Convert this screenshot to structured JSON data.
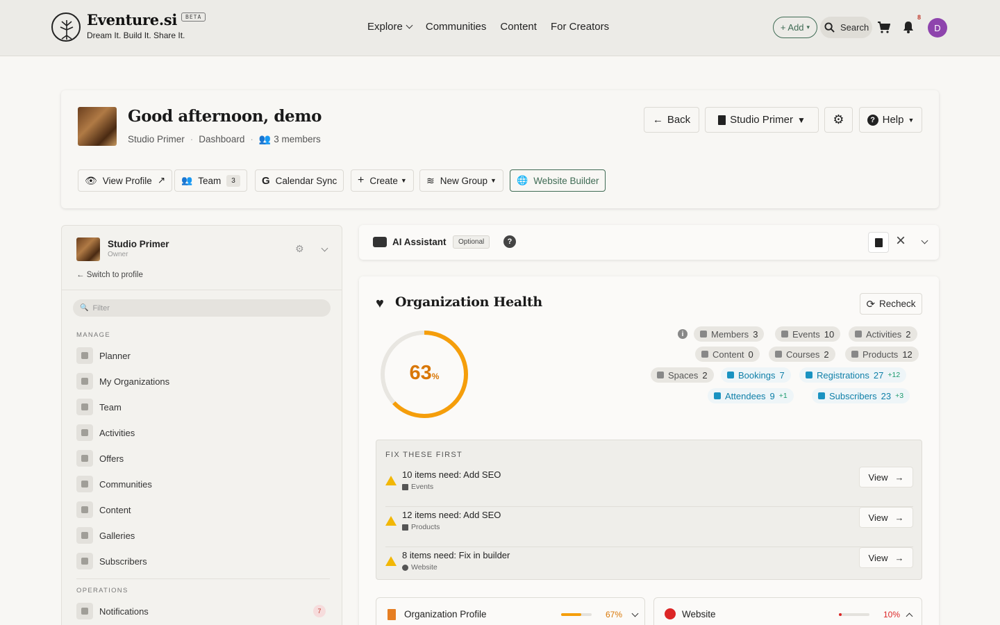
{
  "brand": {
    "name": "Eventure.si",
    "beta": "BETA",
    "tagline": "Dream It. Build It. Share It."
  },
  "nav": {
    "explore": "Explore",
    "communities": "Communities",
    "content": "Content",
    "creators": "For Creators"
  },
  "topbar": {
    "add": "+ Add",
    "search": "Search",
    "notif_count": "8",
    "avatar_initial": "D"
  },
  "header": {
    "greeting": "Good afternoon, demo",
    "org": "Studio Primer",
    "page": "Dashboard",
    "members": "3 members",
    "back": "Back",
    "org_switch": "Studio Primer",
    "help": "Help",
    "actions": {
      "view_profile": "View Profile",
      "team": "Team",
      "team_count": "3",
      "calendar": "Calendar Sync",
      "create": "Create",
      "new_group": "New Group",
      "website": "Website Builder"
    }
  },
  "sidebar": {
    "org_name": "Studio Primer",
    "role": "Owner",
    "switch": "Switch to profile",
    "filter_placeholder": "Filter",
    "manage_label": "MANAGE",
    "items": [
      "Planner",
      "My Organizations",
      "Team",
      "Activities",
      "Offers",
      "Communities",
      "Content",
      "Galleries",
      "Subscribers"
    ],
    "operations_label": "OPERATIONS",
    "notifications": "Notifications",
    "notifications_count": "7"
  },
  "ai": {
    "title": "AI Assistant",
    "optional": "Optional",
    "help": "?"
  },
  "health": {
    "title": "Organization Health",
    "recheck": "Recheck",
    "score": "63",
    "score_unit": "%",
    "score_fraction": 0.63,
    "accent": "#f59e0b",
    "stats": {
      "members_l": "Members",
      "members_v": "3",
      "events_l": "Events",
      "events_v": "10",
      "activities_l": "Activities",
      "activities_v": "2",
      "content_l": "Content",
      "content_v": "0",
      "courses_l": "Courses",
      "courses_v": "2",
      "products_l": "Products",
      "products_v": "12",
      "spaces_l": "Spaces",
      "spaces_v": "2",
      "bookings_l": "Bookings",
      "bookings_v": "7",
      "registrations_l": "Registrations",
      "registrations_v": "27",
      "registrations_d": "+12",
      "attendees_l": "Attendees",
      "attendees_v": "9",
      "attendees_d": "+1",
      "subscribers_l": "Subscribers",
      "subscribers_v": "23",
      "subscribers_d": "+3"
    },
    "fix_header": "FIX THESE FIRST",
    "fixes": [
      {
        "title": "10 items need: Add SEO",
        "sub": "Events",
        "view": "View"
      },
      {
        "title": "12 items need: Add SEO",
        "sub": "Products",
        "view": "View"
      },
      {
        "title": "8 items need: Fix in builder",
        "sub": "Website",
        "view": "View"
      }
    ],
    "profile_card": {
      "title": "Organization Profile",
      "pct": "67%",
      "fraction": 0.67,
      "color": "#f59e0b"
    },
    "website_card": {
      "title": "Website",
      "pct": "10%",
      "fraction": 0.1,
      "color": "#dc2626"
    }
  }
}
